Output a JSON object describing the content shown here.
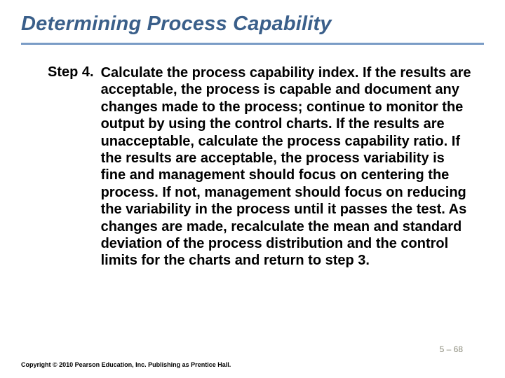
{
  "title": "Determining Process Capability",
  "step": {
    "label": "Step 4.",
    "body": "Calculate the process capability index. If the results are acceptable, the process is capable and document any changes made to the process; continue to monitor the output by using the control charts. If the results are unacceptable, calculate the process capability ratio. If the results are acceptable, the process variability is fine and management should focus on centering the process. If not, management should focus on reducing the variability in the process until it passes the test. As changes are made, recalculate the mean and standard deviation of the process distribution and the control limits for the charts and return to step 3."
  },
  "page_number": "5 – 68",
  "copyright": "Copyright © 2010 Pearson Education, Inc. Publishing as Prentice Hall."
}
